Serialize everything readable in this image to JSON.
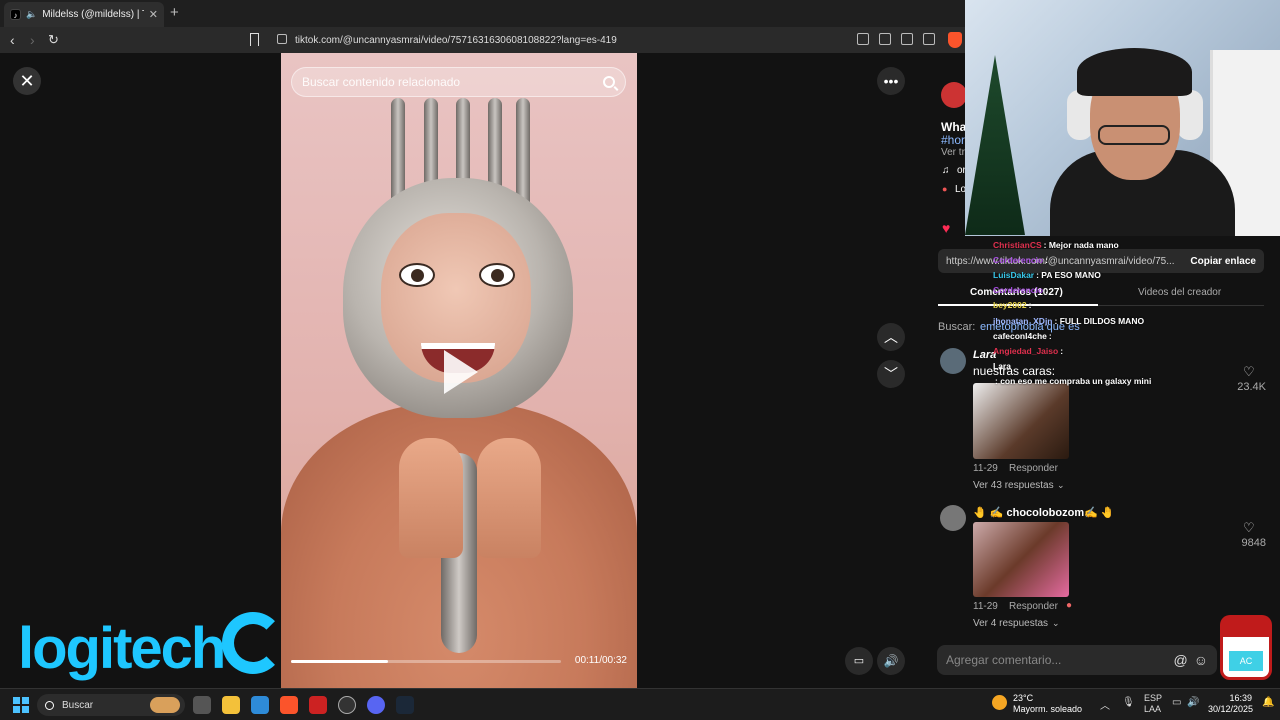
{
  "browser": {
    "tab_title": "Mildelss (@mildelss) | TikTok",
    "url": "tiktok.com/@uncannyasmrai/video/7571631630608108822?lang=es-419"
  },
  "video": {
    "search_placeholder": "Buscar contenido relacionado",
    "time": "00:11/00:32",
    "progress": 0.36
  },
  "panel": {
    "desc_1": "What",
    "desc_2": "#hor",
    "desc_3": "Ver tr",
    "music": "or",
    "location": "Lo",
    "link_url": "https://www.tiktok.com/@uncannyasmrai/video/75...",
    "copy_link": "Copiar enlace",
    "tab_comments": "Comentarios (1027)",
    "tab_creator_videos": "Videos del creador",
    "search_label": "Buscar:",
    "search_term": "emetophobia que es",
    "comments": [
      {
        "user": "Lara",
        "text": "nuestras caras:",
        "date": "11-29",
        "reply": "Responder",
        "likes": "23.4K",
        "replies": "Ver 43 respuestas"
      },
      {
        "user": "🤚 ✍️ chocolobozom✍️ 🤚",
        "text": "",
        "date": "11-29",
        "reply": "Responder",
        "likes": "9848",
        "replies": "Ver 4 respuestas"
      }
    ],
    "add_comment_placeholder": "Agregar comentario..."
  },
  "chat": [
    {
      "user": "ChristianCS",
      "msg": ": Mejor nada mano",
      "color": "#e0304e"
    },
    {
      "user": "Corderencio",
      "msg": ":",
      "color": "#a64ce0"
    },
    {
      "user": "LuisDakar",
      "msg": ": PA ESO MANO",
      "color": "#36c6e8"
    },
    {
      "user": "Corderencio",
      "msg": ":",
      "color": "#a64ce0"
    },
    {
      "user": "bey2002",
      "msg": ":",
      "color": "#e6d24a"
    },
    {
      "user": "jhonatan_XDjn",
      "msg": ": FULL DILDOS MANO",
      "color": "#9fb8ff"
    },
    {
      "user": "cafeconl4che",
      "msg": ":",
      "color": "#ffffff"
    },
    {
      "user": "Angiedad_Jaiso",
      "msg": ":",
      "color": "#e0304e"
    },
    {
      "user": "Lara",
      "msg": "",
      "color": "#ffffff"
    },
    {
      "user": "",
      "msg": ": con eso me compraba un galaxy mini",
      "color": "#a64ce0"
    }
  ],
  "overlay": {
    "logo_text": "logitech",
    "mascot_label": "AC"
  },
  "taskbar": {
    "search": "Buscar",
    "temp": "23°C",
    "weather": "Mayorm. soleado",
    "lang_1": "ESP",
    "lang_2": "LAA",
    "time": "16:39",
    "date": "30/12/2025"
  }
}
